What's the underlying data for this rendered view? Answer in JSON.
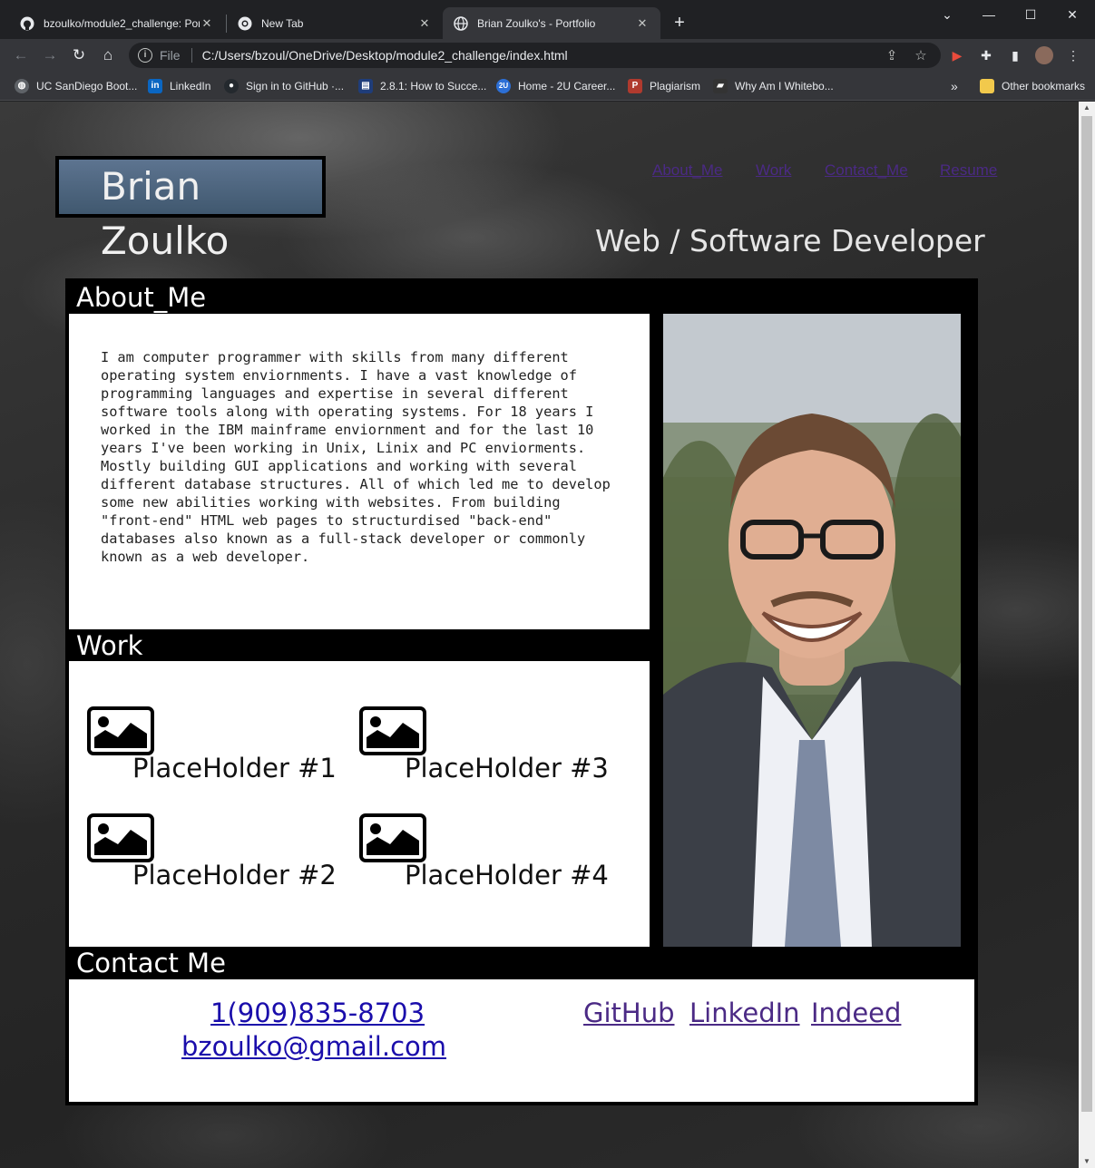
{
  "browser": {
    "tabs": [
      {
        "title": "bzoulko/module2_challenge: Por",
        "icon": "github-icon",
        "active": false
      },
      {
        "title": "New Tab",
        "icon": "chrome-icon",
        "active": false
      },
      {
        "title": "Brian Zoulko's - Portfolio",
        "icon": "globe-icon",
        "active": true
      }
    ],
    "omnibox": {
      "scheme": "File",
      "url": "C:/Users/bzoul/OneDrive/Desktop/module2_challenge/index.html"
    },
    "bookmarks": [
      {
        "label": "UC SanDiego Boot...",
        "icon": "globe-icon",
        "color": "#5f6368"
      },
      {
        "label": "LinkedIn",
        "icon": "linkedin-icon",
        "color": "#0a66c2"
      },
      {
        "label": "Sign in to GitHub ·...",
        "icon": "github-icon",
        "color": "#24292e"
      },
      {
        "label": "2.8.1: How to Succe...",
        "icon": "course-icon",
        "color": "#1f3d7a"
      },
      {
        "label": "Home - 2U Career...",
        "icon": "2u-icon",
        "color": "#2c6fd6"
      },
      {
        "label": "Plagiarism",
        "icon": "plagiarism-icon",
        "color": "#b03a2e"
      },
      {
        "label": "Why Am I Whitebo...",
        "icon": "book-icon",
        "color": "#333333"
      }
    ],
    "other_bookmarks": "Other bookmarks",
    "overflow": "»"
  },
  "page": {
    "logo": "Brian Zoulko",
    "nav": [
      "About_Me",
      "Work",
      "Contact_Me",
      "Resume"
    ],
    "tagline": "Web / Software Developer",
    "about_heading": "About_Me",
    "about_text": "I am computer programmer with skills from many different\noperating system enviornments. I have a vast knowledge of\nprogramming languages and expertise in several different\nsoftware tools along with operating systems. For 18 years I\nworked in the IBM mainframe enviornment and for the last 10\nyears I've been working in Unix, Linix and PC enviorments.\nMostly building GUI applications and working with several\ndifferent database structures. All of which led me to develop\nsome new abilities working with websites. From building\n\"front-end\" HTML web pages to structurdised \"back-end\"\ndatabases also known as a full-stack developer or commonly\nknown as a web developer.",
    "work_heading": "Work",
    "placeholders": [
      "PlaceHolder #1",
      "PlaceHolder #2",
      "PlaceHolder #3",
      "PlaceHolder #4"
    ],
    "contact_heading": "Contact Me",
    "phone": "1(909)835-8703",
    "email": "bzoulko@gmail.com",
    "social": [
      "GitHub",
      "LinkedIn",
      "Indeed"
    ]
  },
  "colors": {
    "visited_link": "#4b2a85",
    "link": "#1a0dab",
    "logo_bg": "#4f6680"
  }
}
